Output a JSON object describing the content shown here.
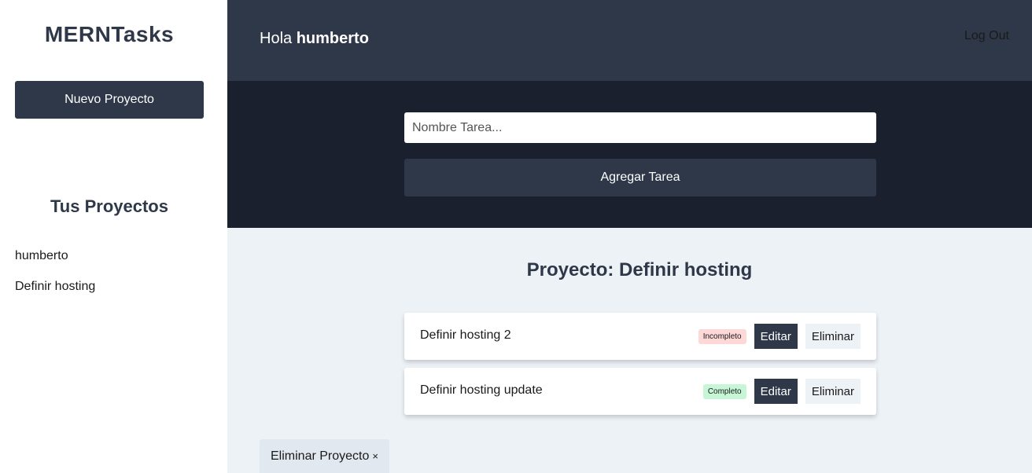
{
  "sidebar": {
    "logo": {
      "bold": "MERN",
      "regular": "Tasks"
    },
    "new_project_label": "Nuevo Proyecto",
    "projects_heading": "Tus Proyectos",
    "projects": [
      {
        "label": "humberto"
      },
      {
        "label": "Definir hosting"
      }
    ]
  },
  "header": {
    "greeting_prefix": "Hola ",
    "user": "humberto",
    "logout_label": "Log Out"
  },
  "form": {
    "placeholder": "Nombre Tarea...",
    "value": "",
    "submit_label": "Agregar Tarea"
  },
  "main": {
    "project_title": "Proyecto: Definir hosting",
    "tasks": [
      {
        "name": "Definir hosting 2",
        "status": "Incompleto",
        "edit_label": "Editar",
        "delete_label": "Eliminar"
      },
      {
        "name": "Definir hosting update",
        "status": "Completo",
        "edit_label": "Editar",
        "delete_label": "Eliminar"
      }
    ],
    "delete_project_label": "Eliminar Proyecto",
    "delete_project_icon": "×"
  },
  "colors": {
    "primary_dark": "#2f3848",
    "darker": "#1a202d",
    "background": "#edf2f7",
    "incompleto": "#fed7d7",
    "completo": "#c6f6d5"
  }
}
